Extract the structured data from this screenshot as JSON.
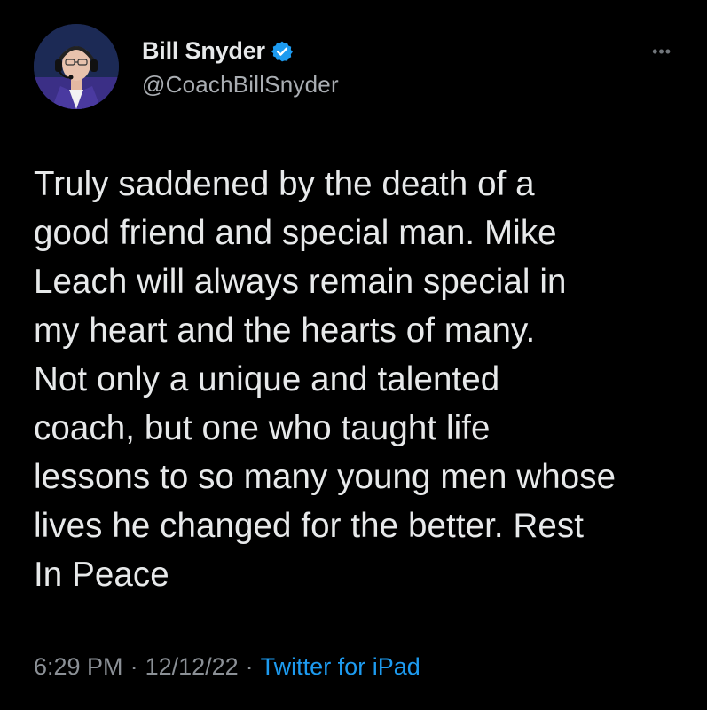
{
  "user": {
    "display_name": "Bill Snyder",
    "handle": "@CoachBillSnyder",
    "verified": true,
    "avatar_icon": "profile-photo",
    "verified_icon": "verified-badge-icon"
  },
  "tweet": {
    "text": "Truly saddened by the death of a\ngood friend and special man. Mike\nLeach will always remain special in\nmy heart  and the hearts of many.\nNot only a unique and talented\ncoach, but one who taught life\nlessons to so many young men whose\nlives he changed for the better. Rest\nIn Peace",
    "time": "6:29 PM",
    "date": "12/12/22",
    "separator": "·",
    "source": "Twitter for iPad"
  },
  "menu": {
    "more_icon": "more-options-icon",
    "more_glyph": "•••"
  },
  "colors": {
    "background": "#000000",
    "text": "#e7e9ea",
    "secondary": "#8b9096",
    "accent": "#1d9bf0"
  }
}
